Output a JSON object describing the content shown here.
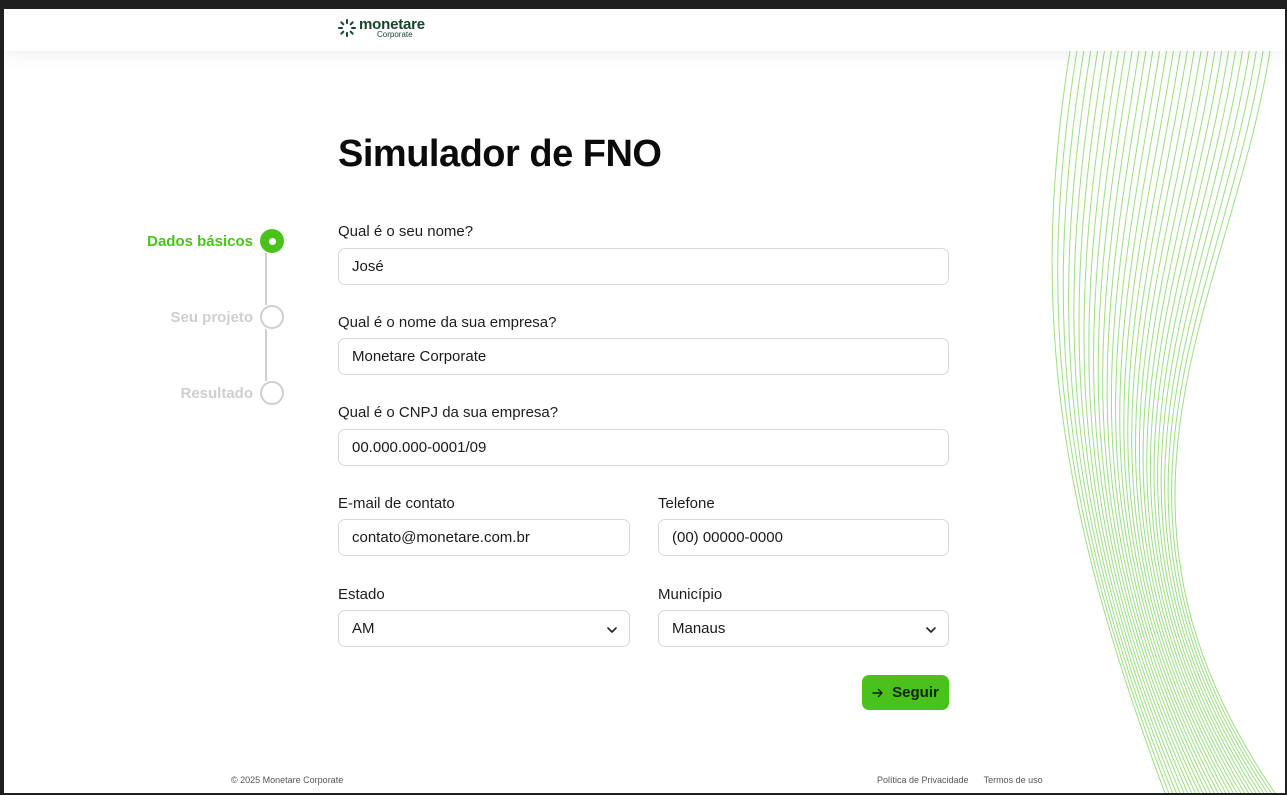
{
  "header": {
    "logo_name": "monetare",
    "logo_sub": "Corporate",
    "logo_icon": "sparkle-logo-icon"
  },
  "page": {
    "title": "Simulador de FNO"
  },
  "steps": [
    {
      "label": "Dados básicos",
      "state": "active"
    },
    {
      "label": "Seu projeto",
      "state": "pending"
    },
    {
      "label": "Resultado",
      "state": "pending"
    }
  ],
  "form": {
    "nome": {
      "label": "Qual é o seu nome?",
      "value": "José"
    },
    "empresa": {
      "label": "Qual é o nome da sua empresa?",
      "value": "Monetare Corporate"
    },
    "cnpj": {
      "label": "Qual é o CNPJ da sua empresa?",
      "value": "00.000.000-0001/09"
    },
    "email": {
      "label": "E-mail de contato",
      "value": "contato@monetare.com.br"
    },
    "telefone": {
      "label": "Telefone",
      "value": "(00) 00000-0000"
    },
    "estado": {
      "label": "Estado",
      "value": "AM"
    },
    "municipio": {
      "label": "Município",
      "value": "Manaus"
    },
    "submit_label": "Seguir"
  },
  "footer": {
    "copyright": "© 2025 Monetare Corporate",
    "privacy": "Política de Privacidade",
    "terms": "Termos de uso"
  },
  "colors": {
    "accent": "#4ac21b",
    "brand": "#16452c",
    "muted": "#cfcfcf"
  }
}
